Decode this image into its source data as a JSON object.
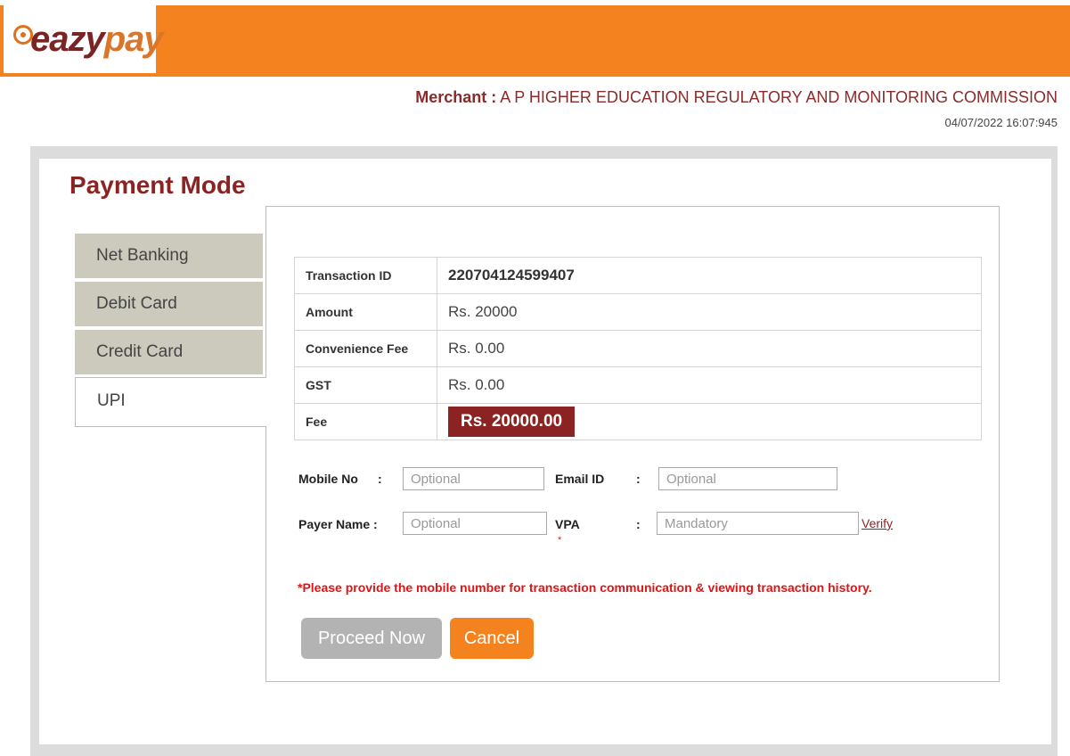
{
  "brand": {
    "logo_text_a": "eazy",
    "logo_text_b": "pay"
  },
  "merchant": {
    "label": "Merchant :",
    "name": "A P HIGHER EDUCATION REGULATORY AND MONITORING COMMISSION",
    "datetime": "04/07/2022 16:07:945"
  },
  "page_title": "Payment Mode",
  "tabs": [
    {
      "label": "Net Banking"
    },
    {
      "label": "Debit Card"
    },
    {
      "label": "Credit Card"
    },
    {
      "label": "UPI"
    }
  ],
  "details": {
    "transaction_id_label": "Transaction ID",
    "transaction_id": "220704124599407",
    "amount_label": "Amount",
    "amount": "Rs. 20000",
    "convenience_fee_label": "Convenience Fee",
    "convenience_fee": "Rs. 0.00",
    "gst_label": "GST",
    "gst": "Rs. 0.00",
    "fee_label": "Fee",
    "fee": "Rs. 20000.00"
  },
  "form": {
    "mobile_label": "Mobile No",
    "mobile_placeholder": "Optional",
    "email_label": "Email ID",
    "email_placeholder": "Optional",
    "payer_label": "Payer Name :",
    "payer_placeholder": "Optional",
    "vpa_label": "VPA",
    "vpa_required_mark": "*",
    "vpa_placeholder": "Mandatory",
    "colon": ":",
    "verify_label": "Verify"
  },
  "note": "*Please provide the mobile number for transaction communication & viewing transaction history.",
  "buttons": {
    "proceed": "Proceed Now",
    "cancel": "Cancel"
  },
  "colors": {
    "brand_orange": "#f4831f",
    "brand_maroon": "#8b2323",
    "tab_gray": "#ccc9bd"
  }
}
